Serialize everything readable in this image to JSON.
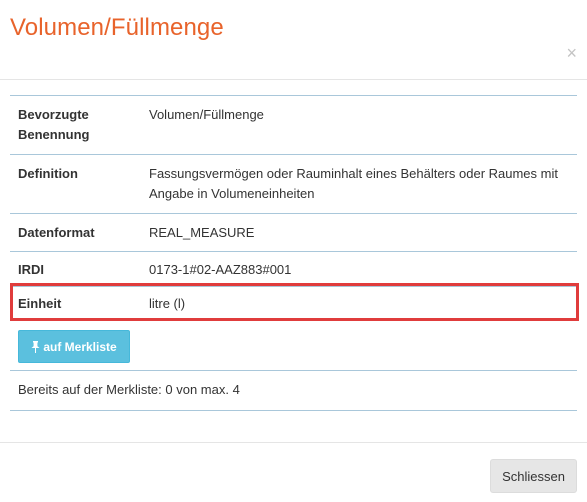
{
  "dialog": {
    "title": "Volumen/Füllmenge",
    "close_glyph": "×"
  },
  "properties": [
    {
      "label": "Bevorzugte Benennung",
      "value": "Volumen/Füllmenge"
    },
    {
      "label": "Definition",
      "value": "Fassungsvermögen oder Rauminhalt eines Behälters oder Raumes mit Angabe in Volumeneinheiten"
    },
    {
      "label": "Datenformat",
      "value": "REAL_MEASURE"
    },
    {
      "label": "IRDI",
      "value": "0173-1#02-AAZ883#001"
    },
    {
      "label": "Einheit",
      "value": "litre (l)"
    }
  ],
  "actions": {
    "merkliste_label": "auf Merkliste",
    "merkliste_icon": "pushpin-icon",
    "merkliste_color": "#5bc0de",
    "status_text": "Bereits auf der Merkliste: 0 von max. 4",
    "close_label": "Schliessen"
  },
  "highlight_color": "#e03c3c",
  "accent_color": "#e8632b"
}
